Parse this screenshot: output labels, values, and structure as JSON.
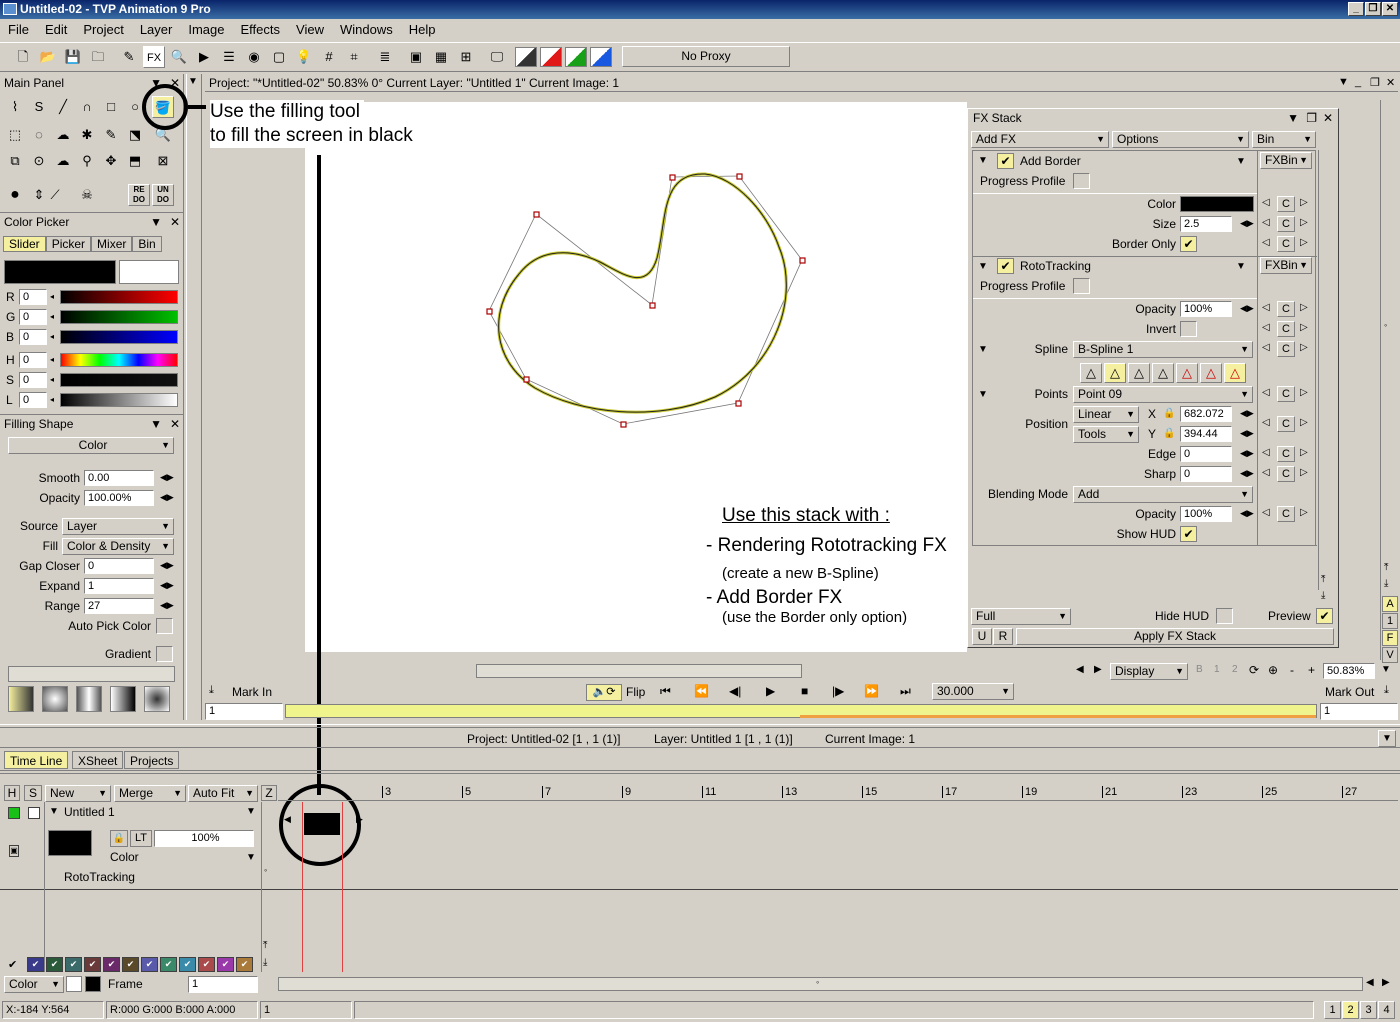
{
  "window": {
    "title": "Untitled-02 - TVP Animation 9 Pro"
  },
  "menu": [
    "File",
    "Edit",
    "Project",
    "Layer",
    "Image",
    "Effects",
    "View",
    "Windows",
    "Help"
  ],
  "toolbar": {
    "proxy": "No Proxy",
    "fx_label": "FX"
  },
  "main_panel": {
    "title": "Main Panel",
    "redo": "RE DO",
    "undo": "UN DO"
  },
  "canvas_header": {
    "text": "Project: \"*Untitled-02\"  50.83%  0°  Current Layer: \"Untitled 1\"  Current Image: 1"
  },
  "annotation": {
    "line1": "Use the filling tool",
    "line2": "to fill the screen in black"
  },
  "color_picker": {
    "title": "Color Picker",
    "tabs": [
      "Slider",
      "Picker",
      "Mixer",
      "Bin"
    ],
    "channels": [
      {
        "label": "R",
        "value": "0"
      },
      {
        "label": "G",
        "value": "0"
      },
      {
        "label": "B",
        "value": "0"
      },
      {
        "label": "H",
        "value": "0"
      },
      {
        "label": "S",
        "value": "0"
      },
      {
        "label": "L",
        "value": "0"
      }
    ],
    "primary_color": "#000000",
    "secondary_color": "#ffffff"
  },
  "filling_shape": {
    "title": "Filling Shape",
    "mode": "Color",
    "smooth_label": "Smooth",
    "smooth": "0.00",
    "opacity_label": "Opacity",
    "opacity": "100.00%",
    "source_label": "Source",
    "source": "Layer",
    "fill_label": "Fill",
    "fill": "Color & Density",
    "gap_label": "Gap Closer",
    "gap": "0",
    "expand_label": "Expand",
    "expand": "1",
    "range_label": "Range",
    "range": "27",
    "autopick_label": "Auto Pick Color",
    "gradient_label": "Gradient"
  },
  "fx_stack": {
    "title": "FX Stack",
    "add_fx": "Add FX",
    "options": "Options",
    "bin": "Bin",
    "add_border": {
      "name": "Add Border",
      "fxbin": "FXBin",
      "progress_label": "Progress Profile",
      "color_label": "Color",
      "size_label": "Size",
      "size": "2.5",
      "border_only_label": "Border Only"
    },
    "rototracking": {
      "name": "RotoTracking",
      "fxbin": "FXBin",
      "progress_label": "Progress Profile",
      "opacity_label": "Opacity",
      "opacity": "100%",
      "invert_label": "Invert",
      "spline_label": "Spline",
      "spline": "B-Spline 1",
      "points_label": "Points",
      "points": "Point 09",
      "position_label": "Position",
      "interp": "Linear",
      "tools": "Tools",
      "x_label": "X",
      "x": "682.072",
      "y_label": "Y",
      "y": "394.44",
      "edge_label": "Edge",
      "edge": "0",
      "sharp_label": "Sharp",
      "sharp": "0",
      "blend_label": "Blending Mode",
      "blend": "Add",
      "opacity2_label": "Opacity",
      "opacity2": "100%",
      "showhud_label": "Show HUD"
    },
    "c_label": "C",
    "full": "Full",
    "hide_hud": "Hide HUD",
    "preview": "Preview",
    "u": "U",
    "r": "R",
    "apply": "Apply FX Stack",
    "side": [
      "A",
      "1",
      "F",
      "V"
    ]
  },
  "canvas_notes": {
    "heading": "Use this stack with :",
    "item1": "- Rendering Rototracking FX",
    "item1_sub": "(create a new B-Spline)",
    "item2": "- Add Border FX",
    "item2_sub": "(use the Border only option)"
  },
  "view_controls": {
    "display": "Display",
    "zoom": "50.83%"
  },
  "player": {
    "mark_in": "Mark In",
    "mark_out": "Mark Out",
    "flip": "Flip",
    "fps": "30.000",
    "in_frame": "1",
    "out_frame": "1"
  },
  "project_info": {
    "project": "Project: Untitled-02 [1 , 1  (1)]",
    "layer": "Layer: Untitled 1 [1 , 1  (1)]",
    "image": "Current Image: 1"
  },
  "timeline": {
    "tabs": [
      "Time Line",
      "XSheet",
      "Projects"
    ],
    "headers": {
      "h": "H",
      "s": "S",
      "new": "New",
      "merge": "Merge",
      "autofit": "Auto Fit",
      "z": "Z"
    },
    "layer_name": "Untitled 1",
    "layer_opacity": "100%",
    "layer_mode": "Color",
    "layer_fx": "RotoTracking",
    "lt": "LT",
    "ruler": [
      "3",
      "5",
      "7",
      "9",
      "11",
      "13",
      "15",
      "17",
      "19",
      "21",
      "23",
      "25",
      "27"
    ],
    "bottom_mode": "Color",
    "frame_label": "Frame",
    "frame_value": "1",
    "swatch_colors": [
      "#3a3a8a",
      "#2a5a3a",
      "#3a6a6a",
      "#6a3a3a",
      "#6a2a6a",
      "#5a4a2a",
      "#5a5aaa",
      "#3a8a6a",
      "#3a8aaa",
      "#aa4a4a",
      "#9a3aaa",
      "#aa7a3a"
    ]
  },
  "status": {
    "coords": "X:-184  Y:564",
    "rgba": "R:000 G:000 B:000 A:000",
    "frame": "1",
    "pages": [
      "1",
      "2",
      "3",
      "4"
    ]
  }
}
